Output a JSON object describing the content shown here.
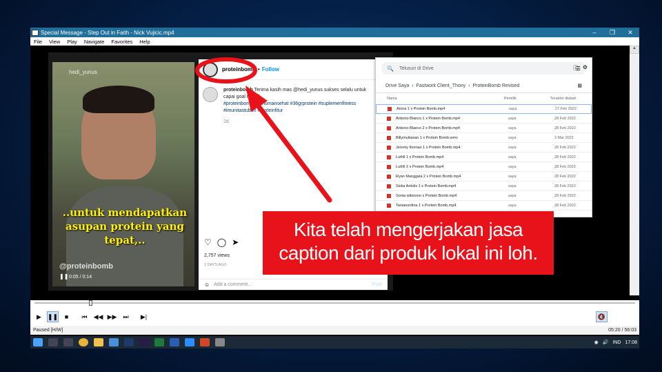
{
  "window": {
    "title": "Special Message - Step Out in Faith - Nick Vujicic.mp4",
    "minimize": "‒",
    "maximize": "❐",
    "close": "✕"
  },
  "menu": [
    "File",
    "View",
    "Play",
    "Navigate",
    "Favorites",
    "Help"
  ],
  "video_caption": "..untuk mendapatkan asupan protein yang tepat,..",
  "video_watermark": "@proteinbomb",
  "video_username": "hedi_yunus",
  "video_time": "0:05 / 0:14",
  "instagram": {
    "account": "proteinbomb",
    "follow": "Follow",
    "caption_user": "proteinbomb",
    "caption_lines": [
      "Terima kasih mas @hedi_yunus sukses selalu untuk",
      "capai goal nya 🙏",
      "#proteinbomb #minumansehat #36grprotein #suplemenfitness",
      "#imunitastubuh #proteinfitur"
    ],
    "age": "2d",
    "views": "2,757 views",
    "posted": "2 DAYS AGO",
    "comment_placeholder": "Add a comment...",
    "post_label": "Post"
  },
  "drive": {
    "search_placeholder": "Telusuri di Drive",
    "breadcrumb": [
      "Drive Saya",
      "Fastwork Client_Thony",
      "ProteinBomb Revised"
    ],
    "columns": [
      "Nama",
      "Pemilik",
      "Terakhir diubah"
    ],
    "rows": [
      {
        "name": "Amira 1 x Protein Bomb.mp4",
        "owner": "saya",
        "date": "27 Feb 2022"
      },
      {
        "name": "Antonio Blanco 1 x Protein Bomb.mp4",
        "owner": "saya",
        "date": "28 Feb 2022"
      },
      {
        "name": "Antonio Blanco 2 x Protein Bomb.mp4",
        "owner": "saya",
        "date": "28 Feb 2022"
      },
      {
        "name": "Billymuliawan 1 x Protein Bomb.wmv",
        "owner": "saya",
        "date": "3 Mar 2022"
      },
      {
        "name": "Jeremy thomas 1 x Protein Bomb.mp4",
        "owner": "saya",
        "date": "28 Feb 2022"
      },
      {
        "name": "Luthfi 1 x Protein Bomb.mp4",
        "owner": "saya",
        "date": "28 Feb 2022"
      },
      {
        "name": "Luthfi 2 x Protein Bomb.mp4",
        "owner": "saya",
        "date": "28 Feb 2022"
      },
      {
        "name": "Ryan Manggala 2 x Protein Bomb.mp4",
        "owner": "saya",
        "date": "28 Feb 2022"
      },
      {
        "name": "Siska Antolis 1 x Protein Bomb.mp4",
        "owner": "saya",
        "date": "28 Feb 2022"
      },
      {
        "name": "Sonia wibisono x Protein Bomb.mp4",
        "owner": "saya",
        "date": "28 Feb 2022"
      },
      {
        "name": "Tanianordina 1 x Protein Bomb.mp4",
        "owner": "saya",
        "date": "28 Feb 2022"
      }
    ]
  },
  "overlay_text": [
    "Kita telah mengerjakan jasa",
    "caption dari produk lokal ini loh."
  ],
  "status": {
    "state": "Paused [H/W]",
    "time": "05:20 / 56:03"
  },
  "taskbar": {
    "lang": "IND",
    "clock": "17:08"
  },
  "colors": {
    "titlebar": "#1f6f9a",
    "overlay": "#e8121b",
    "arrow": "#e8121b",
    "taskbar": "#1c2a38"
  }
}
